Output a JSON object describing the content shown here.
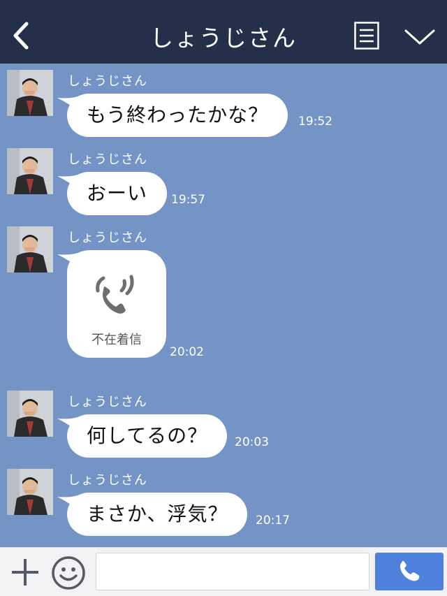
{
  "header": {
    "title": "しょうじさん"
  },
  "messages": [
    {
      "sender": "しょうじさん",
      "text": "もう終わったかな？",
      "time": "19:52"
    },
    {
      "sender": "しょうじさん",
      "text": "おーい",
      "time": "19:57"
    },
    {
      "sender": "しょうじさん",
      "call_label": "不在着信",
      "time": "20:02"
    },
    {
      "sender": "しょうじさん",
      "text": "何してるの？",
      "time": "20:03"
    },
    {
      "sender": "しょうじさん",
      "text": "まさか、浮気？",
      "time": "20:17"
    }
  ],
  "input": {
    "value": "",
    "placeholder": ""
  },
  "colors": {
    "header_bg": "#243049",
    "chat_bg": "#7394c4",
    "send_button": "#4f80dc"
  },
  "icons": [
    "back-icon",
    "memo-icon",
    "chevron-down-icon",
    "plus-icon",
    "emoji-icon",
    "phone-icon",
    "missed-call-icon"
  ]
}
